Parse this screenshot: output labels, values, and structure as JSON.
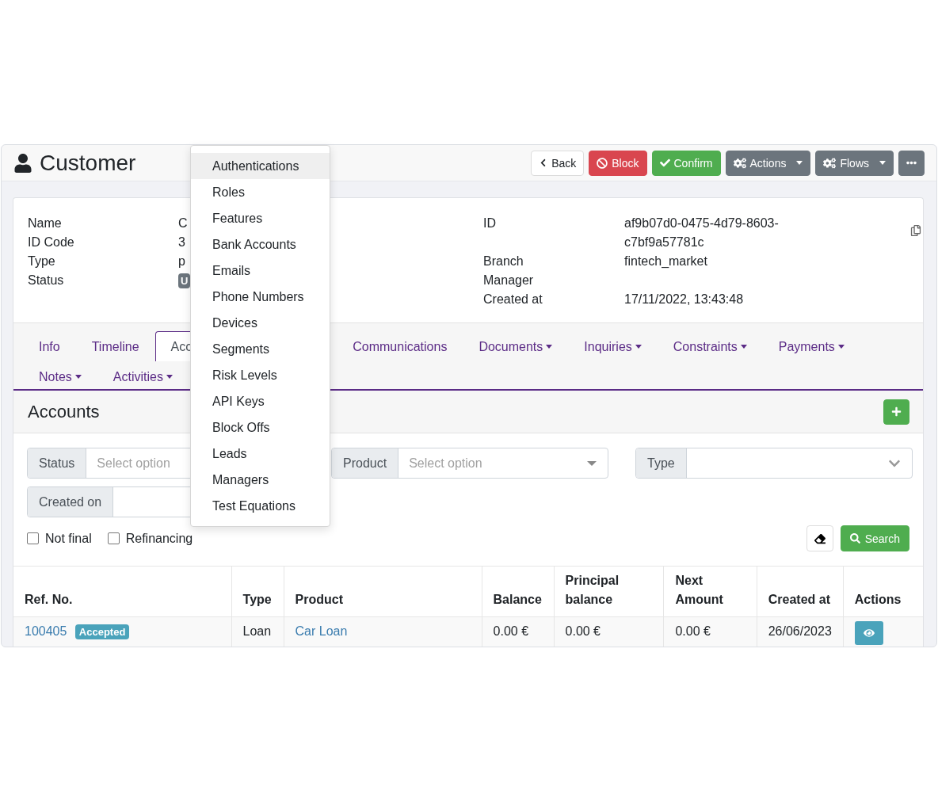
{
  "header": {
    "title": "Customer",
    "buttons": [
      {
        "kind": "back",
        "label": "Back"
      },
      {
        "kind": "block",
        "label": "Block"
      },
      {
        "kind": "confirm",
        "label": "Confirm"
      },
      {
        "kind": "menu",
        "label": "Actions"
      },
      {
        "kind": "menu",
        "label": "Flows"
      },
      {
        "kind": "more"
      }
    ]
  },
  "details": {
    "left": [
      {
        "label": "Name",
        "value": "C",
        "kind": "text"
      },
      {
        "label": "ID Code",
        "value": "3",
        "kind": "text"
      },
      {
        "label": "Type",
        "value": "p",
        "kind": "text"
      },
      {
        "label": "Status",
        "value": "U",
        "kind": "badge"
      }
    ],
    "right": [
      {
        "label": "ID",
        "value": "af9b07d0-0475-4d79-8603-c7bf9a57781c",
        "copyable": true
      },
      {
        "label": "Branch",
        "value": "fintech_market",
        "copyable": false
      },
      {
        "label": "Manager",
        "copyable": false
      },
      {
        "label": "Created at",
        "value": "17/11/2022, 13:43:48",
        "copyable": false
      }
    ]
  },
  "tab_rows": [
    {
      "tabs": [
        {
          "label": "Info",
          "selected": false,
          "has_menu": false
        },
        {
          "label": "Timeline",
          "selected": false,
          "has_menu": false
        },
        {
          "label": "Acc",
          "selected": true,
          "has_menu": false
        },
        {
          "label": "Communications",
          "selected": false,
          "has_menu": false
        },
        {
          "label": "Documents",
          "selected": false,
          "has_menu": true
        },
        {
          "label": "Inquiries",
          "selected": false,
          "has_menu": true
        },
        {
          "label": "Constraints",
          "selected": false,
          "has_menu": true
        },
        {
          "label": "Payments",
          "selected": false,
          "has_menu": true
        }
      ]
    },
    {
      "tabs": [
        {
          "label": "Notes",
          "selected": false,
          "has_menu": true
        },
        {
          "label": "Activities",
          "selected": false,
          "has_menu": true
        }
      ]
    }
  ],
  "dropdown_menu": {
    "items": [
      {
        "label": "Authentications",
        "highlighted": true
      },
      {
        "label": "Roles",
        "highlighted": false
      },
      {
        "label": "Features",
        "highlighted": false
      },
      {
        "label": "Bank Accounts",
        "highlighted": false
      },
      {
        "label": "Emails",
        "highlighted": false
      },
      {
        "label": "Phone Numbers",
        "highlighted": false
      },
      {
        "label": "Devices",
        "highlighted": false
      },
      {
        "label": "Segments",
        "highlighted": false
      },
      {
        "label": "Risk Levels",
        "highlighted": false
      },
      {
        "label": "API Keys",
        "highlighted": false
      },
      {
        "label": "Block Offs",
        "highlighted": false
      },
      {
        "label": "Leads",
        "highlighted": false
      },
      {
        "label": "Managers",
        "highlighted": false
      },
      {
        "label": "Test Equations",
        "highlighted": false
      }
    ]
  },
  "accounts": {
    "title": "Accounts",
    "filters": [
      {
        "label": "Status",
        "kind": "select",
        "placeholder": "Select option"
      },
      {
        "label": "Product",
        "kind": "select",
        "placeholder": "Select option",
        "caret": true
      },
      {
        "label": "Type",
        "kind": "native-select"
      },
      {
        "label": "Created on",
        "kind": "date"
      }
    ],
    "checkboxes": [
      {
        "label": "Not final",
        "checked": false
      },
      {
        "label": "Refinancing",
        "checked": false
      }
    ],
    "search_label": "Search",
    "table": {
      "columns": [
        "Ref. No.",
        "Type",
        "Product",
        "Balance",
        "Principal balance",
        "Next Amount",
        "Created at",
        "Actions"
      ],
      "rows": [
        {
          "ref": "100405",
          "status": "Accepted",
          "type": "Loan",
          "product": "Car Loan",
          "balance": "0.00 €",
          "principal_balance": "0.00 €",
          "next_amount": "0.00 €",
          "created_at": "26/06/2023"
        }
      ]
    }
  }
}
